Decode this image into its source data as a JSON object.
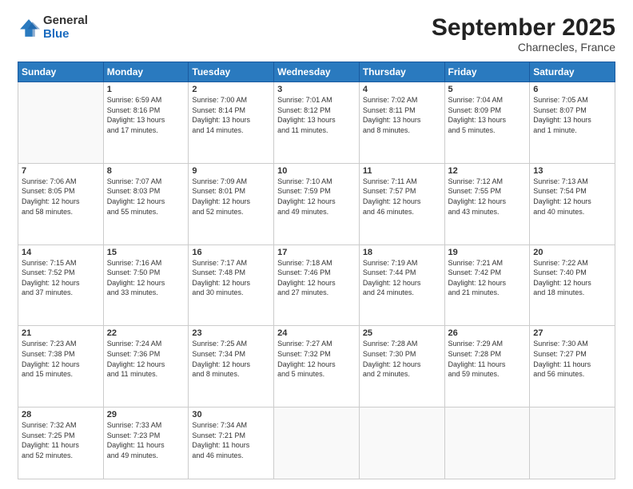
{
  "header": {
    "logo": {
      "general": "General",
      "blue": "Blue"
    },
    "title": "September 2025",
    "location": "Charnecles, France"
  },
  "weekdays": [
    "Sunday",
    "Monday",
    "Tuesday",
    "Wednesday",
    "Thursday",
    "Friday",
    "Saturday"
  ],
  "weeks": [
    [
      {
        "day": "",
        "info": ""
      },
      {
        "day": "1",
        "info": "Sunrise: 6:59 AM\nSunset: 8:16 PM\nDaylight: 13 hours\nand 17 minutes."
      },
      {
        "day": "2",
        "info": "Sunrise: 7:00 AM\nSunset: 8:14 PM\nDaylight: 13 hours\nand 14 minutes."
      },
      {
        "day": "3",
        "info": "Sunrise: 7:01 AM\nSunset: 8:12 PM\nDaylight: 13 hours\nand 11 minutes."
      },
      {
        "day": "4",
        "info": "Sunrise: 7:02 AM\nSunset: 8:11 PM\nDaylight: 13 hours\nand 8 minutes."
      },
      {
        "day": "5",
        "info": "Sunrise: 7:04 AM\nSunset: 8:09 PM\nDaylight: 13 hours\nand 5 minutes."
      },
      {
        "day": "6",
        "info": "Sunrise: 7:05 AM\nSunset: 8:07 PM\nDaylight: 13 hours\nand 1 minute."
      }
    ],
    [
      {
        "day": "7",
        "info": "Sunrise: 7:06 AM\nSunset: 8:05 PM\nDaylight: 12 hours\nand 58 minutes."
      },
      {
        "day": "8",
        "info": "Sunrise: 7:07 AM\nSunset: 8:03 PM\nDaylight: 12 hours\nand 55 minutes."
      },
      {
        "day": "9",
        "info": "Sunrise: 7:09 AM\nSunset: 8:01 PM\nDaylight: 12 hours\nand 52 minutes."
      },
      {
        "day": "10",
        "info": "Sunrise: 7:10 AM\nSunset: 7:59 PM\nDaylight: 12 hours\nand 49 minutes."
      },
      {
        "day": "11",
        "info": "Sunrise: 7:11 AM\nSunset: 7:57 PM\nDaylight: 12 hours\nand 46 minutes."
      },
      {
        "day": "12",
        "info": "Sunrise: 7:12 AM\nSunset: 7:55 PM\nDaylight: 12 hours\nand 43 minutes."
      },
      {
        "day": "13",
        "info": "Sunrise: 7:13 AM\nSunset: 7:54 PM\nDaylight: 12 hours\nand 40 minutes."
      }
    ],
    [
      {
        "day": "14",
        "info": "Sunrise: 7:15 AM\nSunset: 7:52 PM\nDaylight: 12 hours\nand 37 minutes."
      },
      {
        "day": "15",
        "info": "Sunrise: 7:16 AM\nSunset: 7:50 PM\nDaylight: 12 hours\nand 33 minutes."
      },
      {
        "day": "16",
        "info": "Sunrise: 7:17 AM\nSunset: 7:48 PM\nDaylight: 12 hours\nand 30 minutes."
      },
      {
        "day": "17",
        "info": "Sunrise: 7:18 AM\nSunset: 7:46 PM\nDaylight: 12 hours\nand 27 minutes."
      },
      {
        "day": "18",
        "info": "Sunrise: 7:19 AM\nSunset: 7:44 PM\nDaylight: 12 hours\nand 24 minutes."
      },
      {
        "day": "19",
        "info": "Sunrise: 7:21 AM\nSunset: 7:42 PM\nDaylight: 12 hours\nand 21 minutes."
      },
      {
        "day": "20",
        "info": "Sunrise: 7:22 AM\nSunset: 7:40 PM\nDaylight: 12 hours\nand 18 minutes."
      }
    ],
    [
      {
        "day": "21",
        "info": "Sunrise: 7:23 AM\nSunset: 7:38 PM\nDaylight: 12 hours\nand 15 minutes."
      },
      {
        "day": "22",
        "info": "Sunrise: 7:24 AM\nSunset: 7:36 PM\nDaylight: 12 hours\nand 11 minutes."
      },
      {
        "day": "23",
        "info": "Sunrise: 7:25 AM\nSunset: 7:34 PM\nDaylight: 12 hours\nand 8 minutes."
      },
      {
        "day": "24",
        "info": "Sunrise: 7:27 AM\nSunset: 7:32 PM\nDaylight: 12 hours\nand 5 minutes."
      },
      {
        "day": "25",
        "info": "Sunrise: 7:28 AM\nSunset: 7:30 PM\nDaylight: 12 hours\nand 2 minutes."
      },
      {
        "day": "26",
        "info": "Sunrise: 7:29 AM\nSunset: 7:28 PM\nDaylight: 11 hours\nand 59 minutes."
      },
      {
        "day": "27",
        "info": "Sunrise: 7:30 AM\nSunset: 7:27 PM\nDaylight: 11 hours\nand 56 minutes."
      }
    ],
    [
      {
        "day": "28",
        "info": "Sunrise: 7:32 AM\nSunset: 7:25 PM\nDaylight: 11 hours\nand 52 minutes."
      },
      {
        "day": "29",
        "info": "Sunrise: 7:33 AM\nSunset: 7:23 PM\nDaylight: 11 hours\nand 49 minutes."
      },
      {
        "day": "30",
        "info": "Sunrise: 7:34 AM\nSunset: 7:21 PM\nDaylight: 11 hours\nand 46 minutes."
      },
      {
        "day": "",
        "info": ""
      },
      {
        "day": "",
        "info": ""
      },
      {
        "day": "",
        "info": ""
      },
      {
        "day": "",
        "info": ""
      }
    ]
  ]
}
